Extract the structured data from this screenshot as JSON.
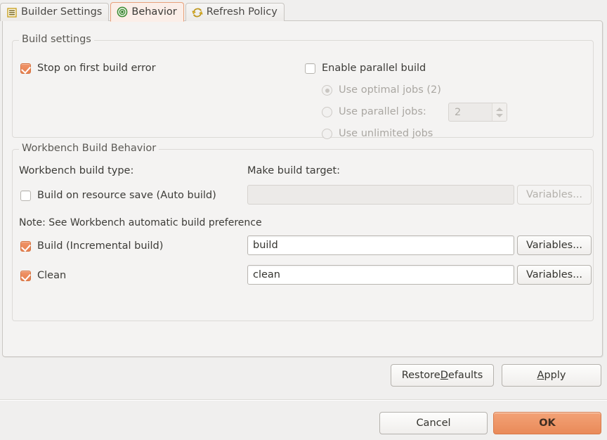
{
  "tabs": [
    {
      "label": "Builder Settings",
      "icon": "list-settings-icon",
      "selected": false
    },
    {
      "label": "Behavior",
      "icon": "target-circle-icon",
      "selected": true
    },
    {
      "label": "Refresh Policy",
      "icon": "refresh-arrows-icon",
      "selected": false
    }
  ],
  "build_settings": {
    "group_title": "Build settings",
    "stop_on_first_error": {
      "label": "Stop on first build error",
      "checked": true
    },
    "enable_parallel_build": {
      "label": "Enable parallel build",
      "checked": false
    },
    "radios": [
      {
        "label": "Use optimal jobs (2)",
        "selected": true,
        "disabled": true
      },
      {
        "label": "Use parallel jobs:",
        "selected": false,
        "disabled": true
      },
      {
        "label": "Use unlimited jobs",
        "selected": false,
        "disabled": true
      }
    ],
    "parallel_jobs_spinner": {
      "value": "2",
      "disabled": true
    }
  },
  "workbench": {
    "group_title": "Workbench Build Behavior",
    "build_type_label": "Workbench build type:",
    "make_target_label": "Make build target:",
    "note": "Note: See Workbench automatic build preference",
    "rows": [
      {
        "checkbox_label": "Build on resource save (Auto build)",
        "checked": false,
        "field_value": "",
        "field_disabled": true,
        "button_label": "Variables...",
        "button_disabled": true
      },
      {
        "checkbox_label": "Build (Incremental build)",
        "checked": true,
        "field_value": "build",
        "field_disabled": false,
        "button_label": "Variables...",
        "button_disabled": false
      },
      {
        "checkbox_label": "Clean",
        "checked": true,
        "field_value": "clean",
        "field_disabled": false,
        "button_label": "Variables...",
        "button_disabled": false
      }
    ]
  },
  "footer": {
    "restore_defaults": {
      "pre": "Restore ",
      "mnemonic": "D",
      "post": "efaults"
    },
    "apply": {
      "pre": "",
      "mnemonic": "A",
      "post": "pply"
    },
    "cancel": "Cancel",
    "ok": "OK"
  },
  "colors": {
    "accent": "#e8804f",
    "tab_selected_bg": "#fbeee8",
    "tab_selected_border": "#e8a07a",
    "panel_bg": "#f4f3f2",
    "dialog_bg": "#f0efee",
    "primary_button": "#e98a59"
  }
}
